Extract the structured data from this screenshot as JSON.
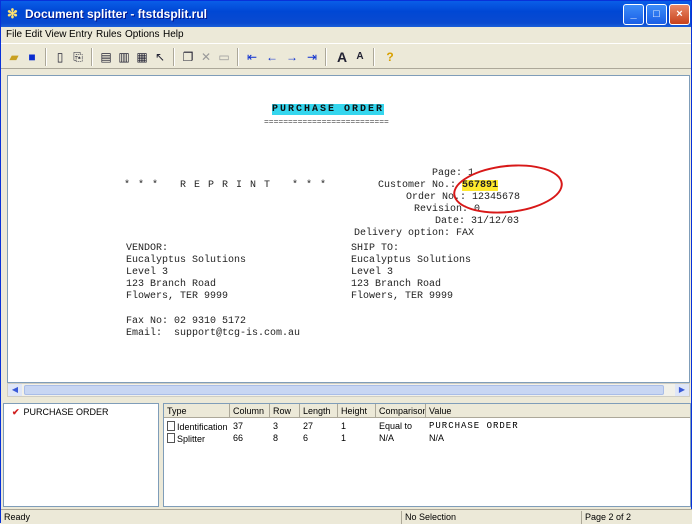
{
  "window": {
    "title": "Document splitter - ftstdsplit.rul",
    "min_glyph": "_",
    "max_glyph": "□",
    "close_glyph": "×"
  },
  "menu": [
    "File",
    "Edit",
    "View",
    "Entry",
    "Rules",
    "Options",
    "Help"
  ],
  "document": {
    "title_text": "PURCHASE ORDER",
    "underline": "==========================",
    "reprint": "* * *   R E P R I N T   * * *",
    "page_label": "Page:",
    "page_value": "1",
    "customer_label": "Customer No.:",
    "customer_value": "567891",
    "order_label": "Order No.:",
    "order_value": "12345678",
    "revision_label": "Revision:",
    "revision_value": "0",
    "date_label": "Date:",
    "date_value": "31/12/03",
    "delivery_label": "Delivery option:",
    "delivery_value": "FAX",
    "vendor_heading": "VENDOR:",
    "vendor_lines": [
      "Eucalyptus Solutions",
      "Level 3",
      "123 Branch Road",
      "Flowers, TER 9999"
    ],
    "shipto_heading": "SHIP TO:",
    "shipto_lines": [
      "Eucalyptus Solutions",
      "Level 3",
      "123 Branch Road",
      "Flowers, TER 9999"
    ],
    "fax_line": "Fax No: 02 9310 5172",
    "email_line": "Email:  support@tcg-is.com.au"
  },
  "rules_tree": {
    "node_label": "PURCHASE ORDER"
  },
  "rules_grid": {
    "columns": [
      "Type",
      "Column",
      "Row",
      "Length",
      "Height",
      "Comparison",
      "Value"
    ],
    "rows": [
      {
        "type": "Identification",
        "column": "37",
        "row": "3",
        "length": "27",
        "height": "1",
        "comparison": "Equal to",
        "value": "PURCHASE ORDER"
      },
      {
        "type": "Splitter",
        "column": "66",
        "row": "8",
        "length": "6",
        "height": "1",
        "comparison": "N/A",
        "value": "N/A"
      }
    ]
  },
  "status": {
    "left": "Ready",
    "selection": "No Selection",
    "page": "Page 2 of 2"
  },
  "colors": {
    "title_highlight": "#35d6ee",
    "value_highlight": "#ffe92e",
    "annotation_circle": "#d81818"
  }
}
